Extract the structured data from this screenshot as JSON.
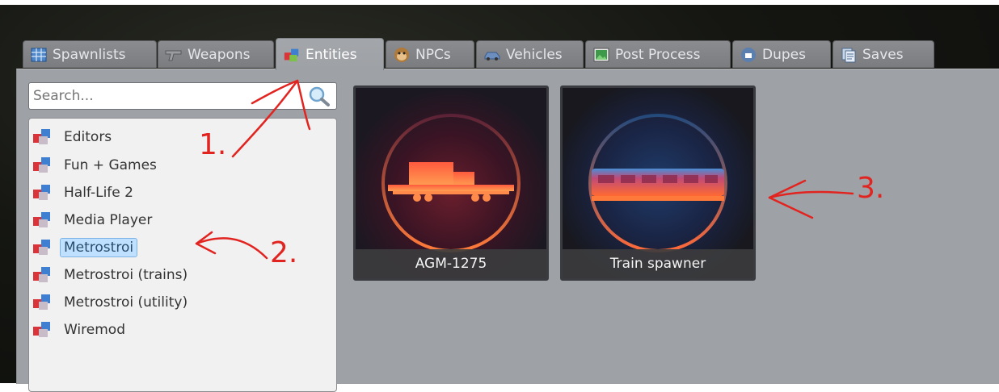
{
  "tabs": [
    {
      "label": "Spawnlists",
      "icon": "grid-icon"
    },
    {
      "label": "Weapons",
      "icon": "gun-icon"
    },
    {
      "label": "Entities",
      "icon": "cubes-icon",
      "active": true
    },
    {
      "label": "NPCs",
      "icon": "monkey-face-icon"
    },
    {
      "label": "Vehicles",
      "icon": "car-icon"
    },
    {
      "label": "Post Process",
      "icon": "image-icon"
    },
    {
      "label": "Dupes",
      "icon": "dupe-icon"
    },
    {
      "label": "Saves",
      "icon": "saves-icon"
    }
  ],
  "search": {
    "placeholder": "Search..."
  },
  "categories": [
    {
      "label": "Editors"
    },
    {
      "label": "Fun + Games"
    },
    {
      "label": "Half-Life 2"
    },
    {
      "label": "Media Player"
    },
    {
      "label": "Metrostroi",
      "selected": true
    },
    {
      "label": "Metrostroi (trains)"
    },
    {
      "label": "Metrostroi (utility)"
    },
    {
      "label": "Wiremod"
    }
  ],
  "entities": [
    {
      "label": "AGM-1275",
      "icon": "flatbed-railcar-icon"
    },
    {
      "label": "Train spawner",
      "icon": "train-icon"
    }
  ],
  "annotations": {
    "one": "1.",
    "two": "2.",
    "three": "3."
  },
  "colors": {
    "annotation": "#e22420",
    "panel": "#9ea1a5",
    "selection": "#bfe1ff"
  }
}
